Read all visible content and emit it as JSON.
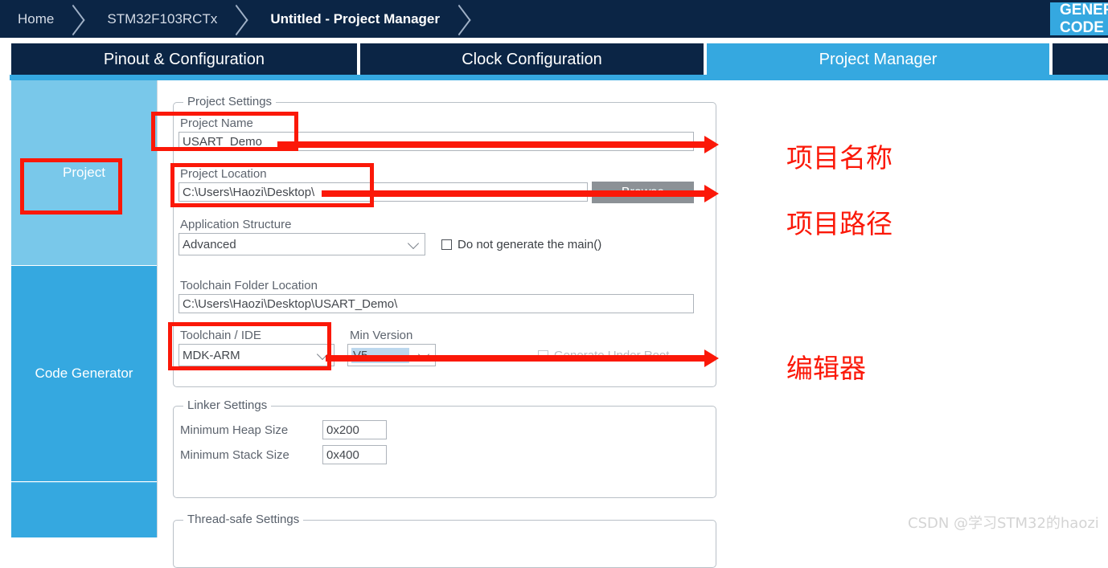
{
  "breadcrumb": {
    "items": [
      {
        "label": "Home",
        "active": false
      },
      {
        "label": "STM32F103RCTx",
        "active": false
      },
      {
        "label": "Untitled - Project Manager",
        "active": true
      }
    ],
    "generate_button_label": "GENERATE CODE"
  },
  "tabs": [
    {
      "label": "Pinout & Configuration",
      "selected": false
    },
    {
      "label": "Clock Configuration",
      "selected": false
    },
    {
      "label": "Project Manager",
      "selected": true
    }
  ],
  "sidebar": {
    "items": [
      {
        "label": "Project",
        "selected": true
      },
      {
        "label": "Code Generator",
        "selected": false
      },
      {
        "label": "",
        "selected": false
      }
    ]
  },
  "project_settings": {
    "group_title": "Project Settings",
    "project_name_label": "Project Name",
    "project_name_value": "USART_Demo",
    "project_location_label": "Project Location",
    "project_location_value": "C:\\Users\\Haozi\\Desktop\\",
    "browse_label": "Browse",
    "application_structure_label": "Application Structure",
    "application_structure_value": "Advanced",
    "do_not_generate_main_label": "Do not generate the main()",
    "toolchain_folder_label": "Toolchain Folder Location",
    "toolchain_folder_value": "C:\\Users\\Haozi\\Desktop\\USART_Demo\\",
    "toolchain_ide_label": "Toolchain / IDE",
    "toolchain_ide_value": "MDK-ARM",
    "min_version_label": "Min Version",
    "min_version_value": "V5",
    "generate_under_root_label": "Generate Under Root"
  },
  "linker_settings": {
    "group_title": "Linker Settings",
    "min_heap_label": "Minimum Heap Size",
    "min_heap_value": "0x200",
    "min_stack_label": "Minimum Stack Size",
    "min_stack_value": "0x400"
  },
  "thread_safe_settings": {
    "group_title": "Thread-safe Settings"
  },
  "annotations": [
    {
      "text": "项目名称"
    },
    {
      "text": "项目路径"
    },
    {
      "text": "编辑器"
    }
  ],
  "watermark": "CSDN @学习STM32的haozi",
  "colors": {
    "navy": "#0b2545",
    "accent_blue": "#35a8e0",
    "light_blue": "#79c8ea",
    "annotation_red": "#fb1808"
  }
}
